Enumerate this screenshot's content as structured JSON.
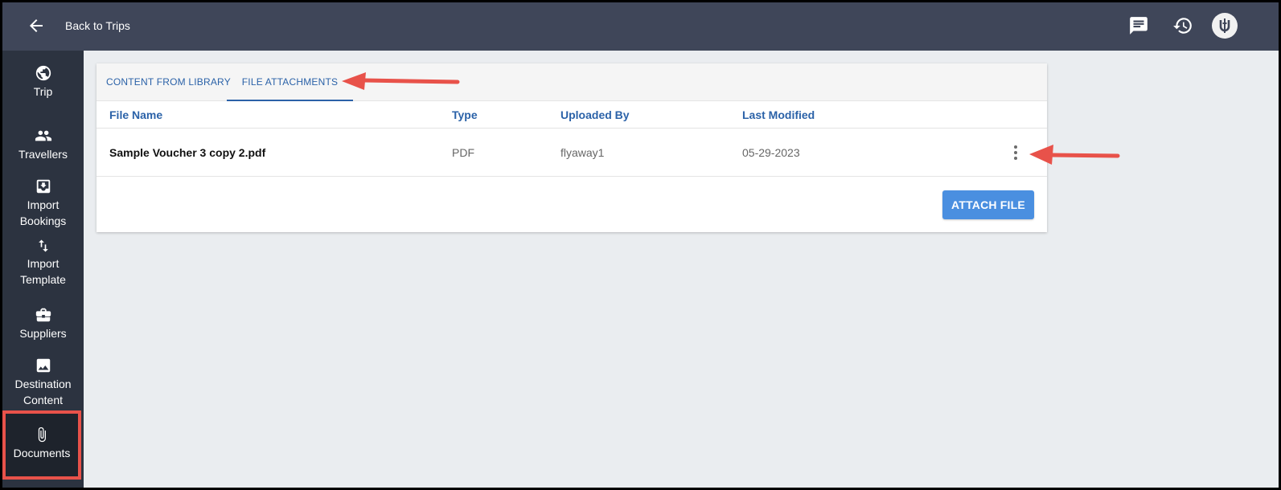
{
  "header": {
    "back_label": "Back to Trips",
    "icons": [
      "back-arrow-icon",
      "chat-icon",
      "history-icon",
      "avatar-logo-icon"
    ]
  },
  "sidebar": {
    "items": [
      {
        "label": "Trip",
        "icon": "globe-icon"
      },
      {
        "label": "Travellers",
        "icon": "people-icon"
      },
      {
        "label": "Import Bookings",
        "icon": "inbox-download-icon"
      },
      {
        "label": "Import Template",
        "icon": "swap-vertical-icon"
      },
      {
        "label": "Suppliers",
        "icon": "briefcase-icon"
      },
      {
        "label": "Destination Content",
        "icon": "image-icon"
      },
      {
        "label": "Documents",
        "icon": "paperclip-icon",
        "active": true
      }
    ]
  },
  "tabs": [
    {
      "label": "CONTENT FROM LIBRARY",
      "active": false
    },
    {
      "label": "FILE ATTACHMENTS",
      "active": true
    }
  ],
  "table": {
    "columns": [
      "File Name",
      "Type",
      "Uploaded By",
      "Last Modified"
    ],
    "rows": [
      {
        "file_name": "Sample Voucher 3 copy 2.pdf",
        "type": "PDF",
        "uploaded_by": "flyaway1",
        "last_modified": "05-29-2023"
      }
    ]
  },
  "attach_label": "ATTACH FILE",
  "colors": {
    "topbar": "#3f4659",
    "sidebar": "#2c3340",
    "accent_blue": "#2b62a8",
    "button_blue": "#4a8fe0",
    "annotation_red": "#e8524a"
  }
}
